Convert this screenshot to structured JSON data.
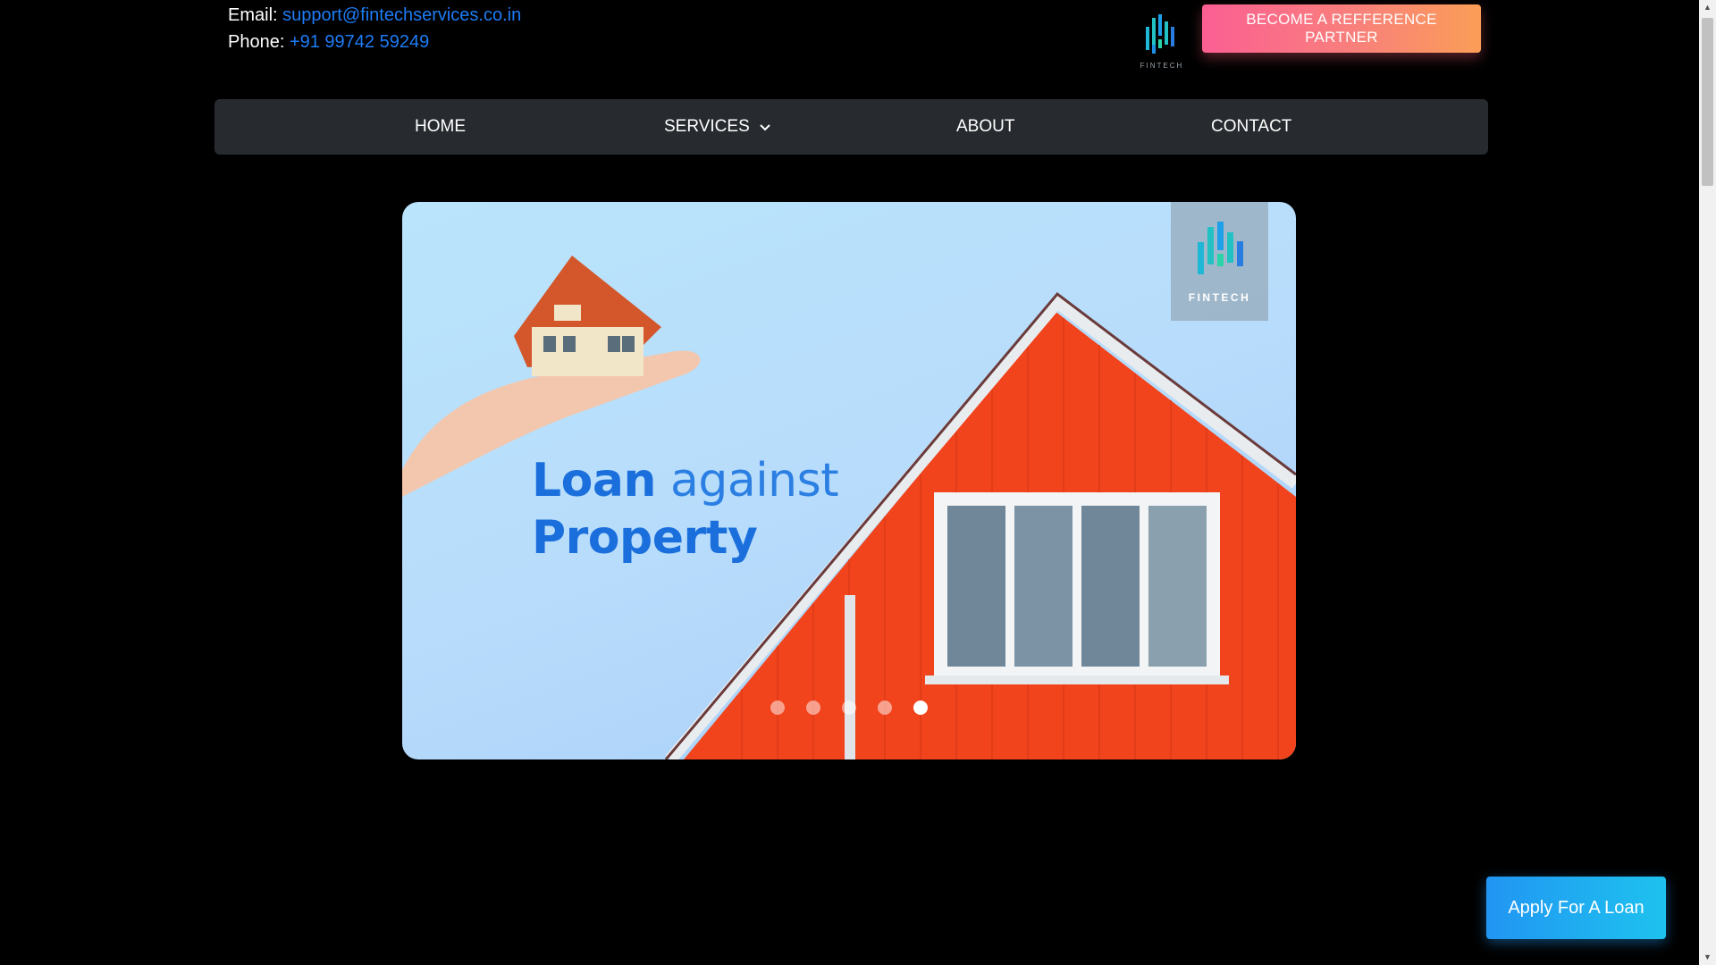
{
  "contact": {
    "email_label": "Email:",
    "email_value": "support@fintechservices.co.in",
    "phone_label": "Phone:",
    "phone_value": "+91 99742 59249"
  },
  "logo": {
    "brand_text": "FINTECH"
  },
  "header": {
    "partner_button_label": "BECOME A REFFERENCE PARTNER"
  },
  "nav": {
    "items": [
      {
        "label": "HOME"
      },
      {
        "label": "SERVICES"
      },
      {
        "label": "ABOUT"
      },
      {
        "label": "CONTACT"
      }
    ]
  },
  "slider": {
    "title_bold_1": "Loan",
    "title_light_1": "against",
    "title_bold_2": "Property",
    "logo_text": "FINTECH",
    "slide_count": 5,
    "active_slide": 5
  },
  "apply_button_label": "Apply For A Loan",
  "colors": {
    "background": "#000000",
    "link": "#1e7cf5",
    "navbar": "#272b2f",
    "partner_gradient_start": "#fb5f93",
    "partner_gradient_end": "#fb9e57",
    "apply_gradient_start": "#2196f3",
    "apply_gradient_end": "#1ec2ee",
    "house_siding": "#f1431c"
  },
  "icons": {
    "services_dropdown": "chevron-down-icon",
    "scroll_up": "arrow-up-icon",
    "scroll_down": "arrow-down-icon"
  }
}
